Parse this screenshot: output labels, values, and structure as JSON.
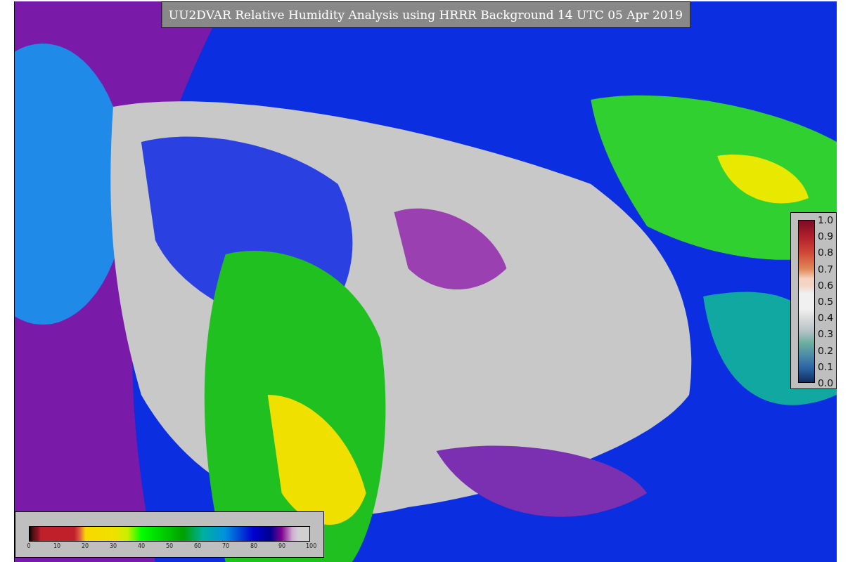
{
  "title": "UU2DVAR Relative Humidity Analysis using HRRR Background 14 UTC 05 Apr 2019",
  "humidity_colorbar": {
    "ticks": [
      "0",
      "10",
      "20",
      "30",
      "40",
      "50",
      "60",
      "70",
      "80",
      "90",
      "100"
    ]
  },
  "ratio_colorbar": {
    "ticks": [
      "1.0",
      "0.9",
      "0.8",
      "0.7",
      "0.6",
      "0.5",
      "0.4",
      "0.3",
      "0.2",
      "0.1",
      "0.0"
    ]
  }
}
